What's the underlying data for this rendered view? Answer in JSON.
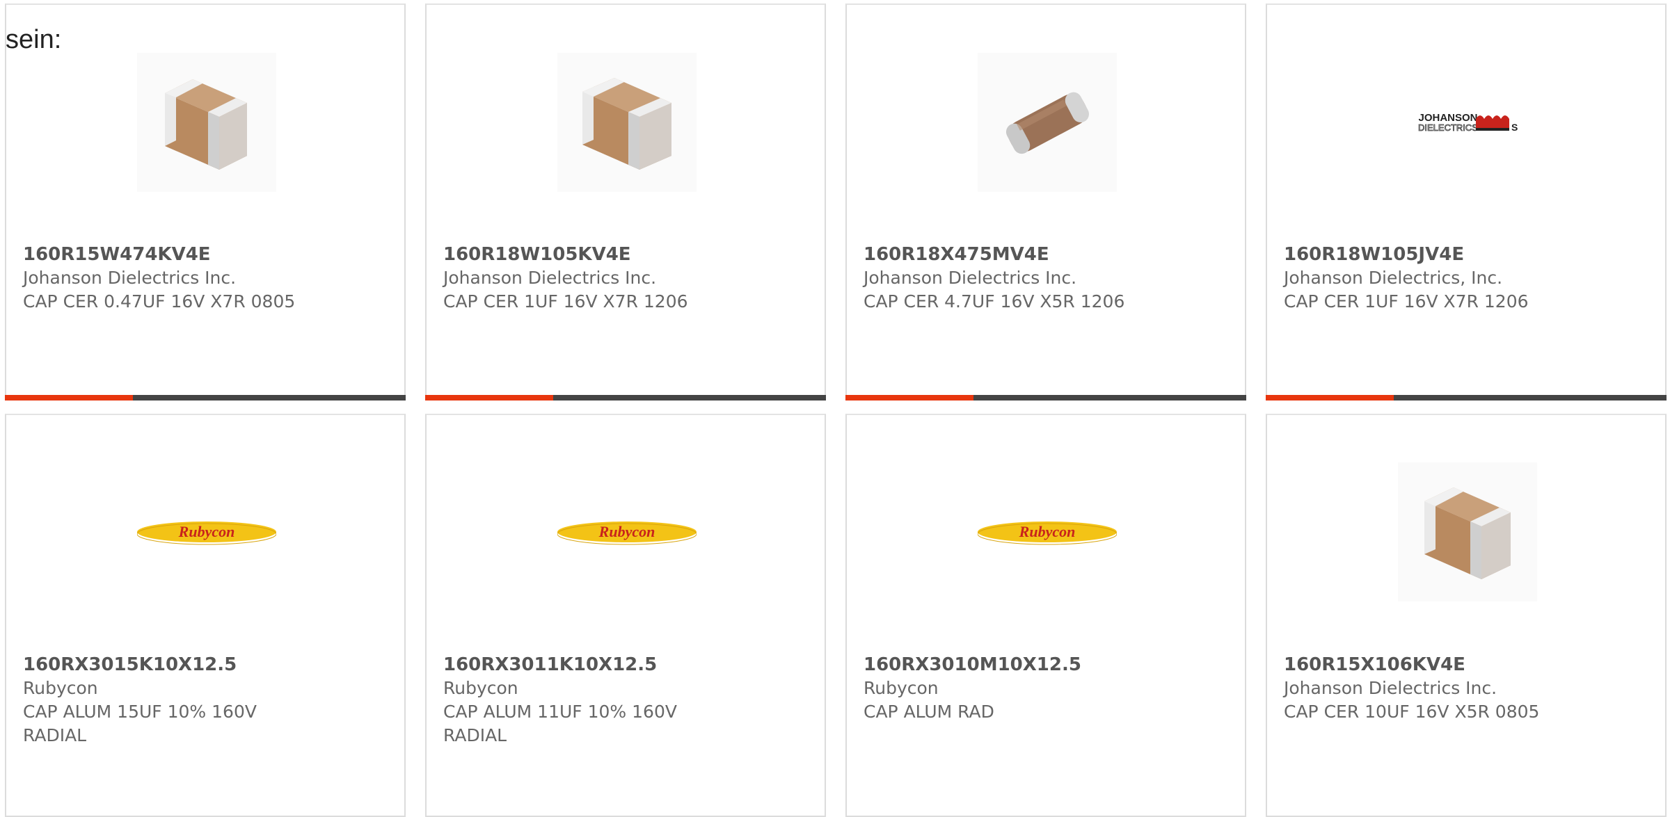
{
  "intro_text": "sein:",
  "colors": {
    "accent": "#e8360e",
    "bar": "#444444",
    "card_border": "#dcdcdc",
    "text": "#666666",
    "rubycon_yellow": "#f3c316",
    "rubycon_red": "#c8231c"
  },
  "products": [
    {
      "part_number": "160R15W474KV4E",
      "manufacturer": "Johanson Dielectrics Inc.",
      "description": "CAP CER 0.47UF 16V X7R 0805",
      "image": "ceramic-chip-capacitor-image"
    },
    {
      "part_number": "160R18W105KV4E",
      "manufacturer": "Johanson Dielectrics Inc.",
      "description": "CAP CER 1UF 16V X7R 1206",
      "image": "ceramic-chip-capacitor-image"
    },
    {
      "part_number": "160R18X475MV4E",
      "manufacturer": "Johanson Dielectrics Inc.",
      "description": "CAP CER 4.7UF 16V X5R 1206",
      "image": "rounded-chip-capacitor-image"
    },
    {
      "part_number": "160R18W105JV4E",
      "manufacturer": "Johanson Dielectrics, Inc.",
      "description": "CAP CER 1UF 16V X7R 1206",
      "image": "johanson-dielectrics-logo",
      "logo_text_line1": "JOHANSON",
      "logo_text_line2": "DIELECTRICS"
    },
    {
      "part_number": "160RX3015K10X12.5",
      "manufacturer": "Rubycon",
      "description": "CAP ALUM 15UF 10% 160V RADIAL",
      "image": "rubycon-logo",
      "logo_text": "Rubycon"
    },
    {
      "part_number": "160RX3011K10X12.5",
      "manufacturer": "Rubycon",
      "description": "CAP ALUM 11UF 10% 160V RADIAL",
      "image": "rubycon-logo",
      "logo_text": "Rubycon"
    },
    {
      "part_number": "160RX3010M10X12.5",
      "manufacturer": "Rubycon",
      "description": "CAP ALUM RAD",
      "image": "rubycon-logo",
      "logo_text": "Rubycon"
    },
    {
      "part_number": "160R15X106KV4E",
      "manufacturer": "Johanson Dielectrics Inc.",
      "description": "CAP CER 10UF 16V X5R 0805",
      "image": "ceramic-chip-capacitor-image"
    }
  ]
}
